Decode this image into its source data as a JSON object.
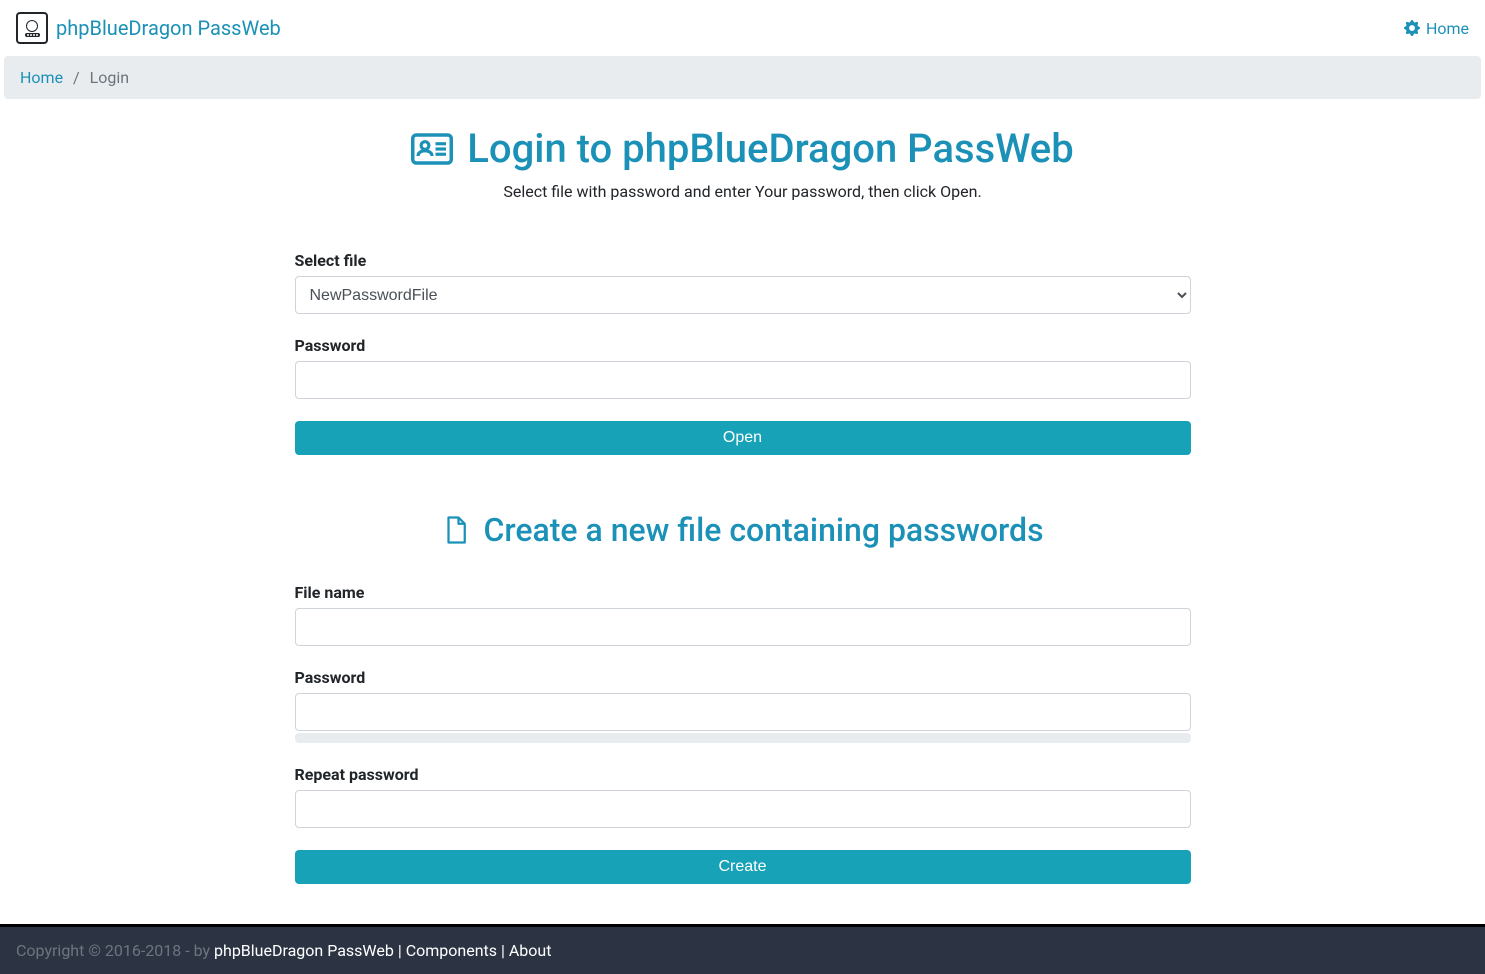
{
  "navbar": {
    "brand": "phpBlueDragon PassWeb",
    "home_link": "Home"
  },
  "breadcrumb": {
    "home": "Home",
    "current": "Login"
  },
  "login": {
    "title": "Login to phpBlueDragon PassWeb",
    "subtitle": "Select file with password and enter Your password, then click Open.",
    "select_file_label": "Select file",
    "select_file_value": "NewPasswordFile",
    "password_label": "Password",
    "password_value": "",
    "open_button": "Open"
  },
  "create": {
    "title": "Create a new file containing passwords",
    "filename_label": "File name",
    "filename_value": "",
    "password_label": "Password",
    "password_value": "",
    "repeat_password_label": "Repeat password",
    "repeat_password_value": "",
    "create_button": "Create"
  },
  "footer": {
    "copyright_prefix": "Copyright © 2016-2018 - by ",
    "brand": "phpBlueDragon PassWeb",
    "sep": " | ",
    "components": "Components",
    "about": "About"
  }
}
